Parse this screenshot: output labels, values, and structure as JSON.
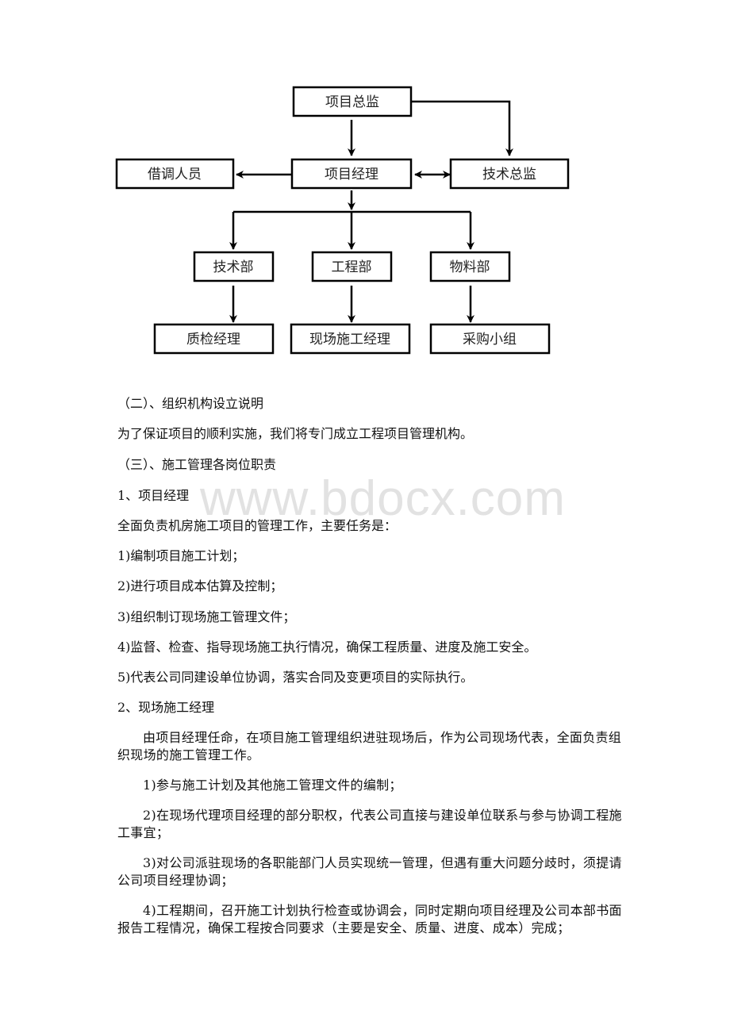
{
  "org_chart": {
    "boxes": {
      "project_director": "项目总监",
      "seconded_staff": "借调人员",
      "project_manager": "项目经理",
      "technical_director": "技术总监",
      "tech_dept": "技术部",
      "engineering_dept": "工程部",
      "materials_dept": "物料部",
      "qc_manager": "质检经理",
      "site_manager": "现场施工经理",
      "purchasing_team": "采购小组"
    }
  },
  "watermark": "www.bdocx.com",
  "sections": {
    "section2_heading": "（二）、组织机构设立说明",
    "section2_body": "为了保证项目的顺利实施，我们将专门成立工程项目管理机构。",
    "section3_heading": "（三）、施工管理各岗位职责",
    "role1": {
      "title": "1、项目经理",
      "intro": "全面负责机房施工项目的管理工作，主要任务是：",
      "items": [
        "1)编制项目施工计划；",
        "2)进行项目成本估算及控制；",
        "3)组织制订现场施工管理文件；",
        "4)监督、检查、指导现场施工执行情况，确保工程质量、进度及施工安全。",
        "5)代表公司同建设单位协调，落实合同及变更项目的实际执行。"
      ]
    },
    "role2": {
      "title": "2、现场施工经理",
      "intro": "由项目经理任命，在项目施工管理组织进驻现场后，作为公司现场代表，全面负责组织现场的施工管理工作。",
      "items": [
        "1)参与施工计划及其他施工管理文件的编制；",
        "2)在现场代理项目经理的部分职权，代表公司直接与建设单位联系与参与协调工程施工事宜；",
        "3)对公司派驻现场的各职能部门人员实现统一管理，但遇有重大问题分歧时，须提请公司项目经理协调；",
        "4)工程期间，召开施工计划执行检查或协调会，同时定期向项目经理及公司本部书面报告工程情况，确保工程按合同要求（主要是安全、质量、进度、成本）完成；"
      ]
    }
  }
}
